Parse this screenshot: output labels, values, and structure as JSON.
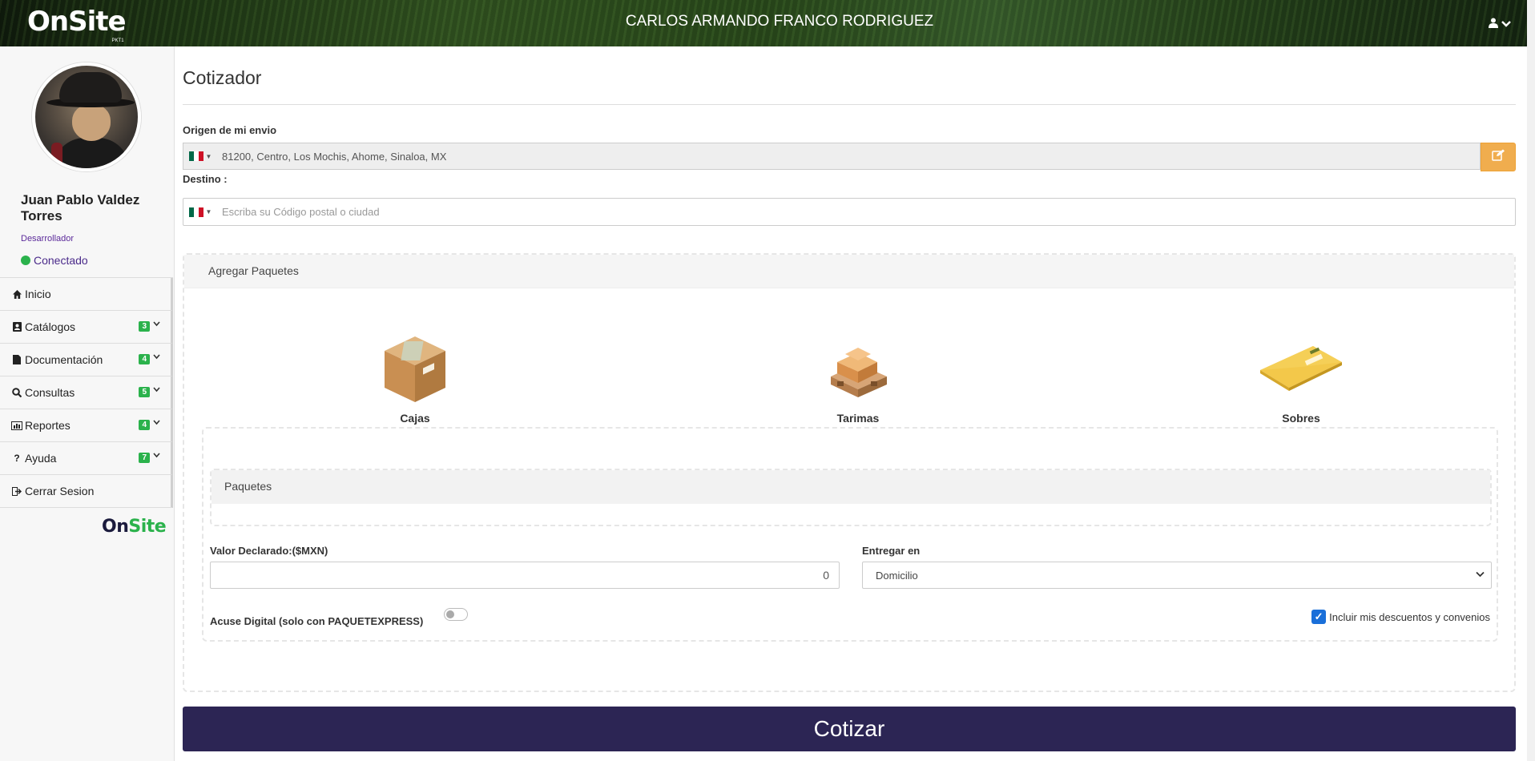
{
  "header": {
    "logo": "OnSite",
    "logo_sub": "PKT1",
    "user_full_name": "CARLOS ARMANDO FRANCO RODRIGUEZ",
    "user_icon": "user-icon",
    "dropdown_icon": "chevron-down-icon"
  },
  "sidebar": {
    "profile": {
      "name": "Juan Pablo Valdez Torres",
      "role": "Desarrollador",
      "status": "Conectado",
      "status_color": "#2bb24c"
    },
    "items": [
      {
        "label": "Inicio",
        "icon": "home-icon"
      },
      {
        "label": "Catálogos",
        "icon": "address-book-icon",
        "badge": "3"
      },
      {
        "label": "Documentación",
        "icon": "file-icon",
        "badge": "4"
      },
      {
        "label": "Consultas",
        "icon": "search-icon",
        "badge": "5"
      },
      {
        "label": "Reportes",
        "icon": "bar-chart-icon",
        "badge": "4"
      },
      {
        "label": "Ayuda",
        "icon": "question-icon",
        "badge": "7"
      },
      {
        "label": "Cerrar Sesion",
        "icon": "sign-out-icon"
      }
    ],
    "footer_logo": {
      "part1": "On",
      "part2": "Site"
    }
  },
  "main": {
    "title": "Cotizador",
    "origin_label": "Origen de mi envio",
    "origin_value": "81200, Centro, Los Mochis, Ahome, Sinaloa, MX",
    "destination_label": "Destino :",
    "destination_placeholder": "Escriba su Código postal o ciudad",
    "packages_panel": {
      "title": "Agregar Paquetes",
      "types": [
        {
          "label": "Cajas",
          "icon": "box-icon"
        },
        {
          "label": "Tarimas",
          "icon": "pallet-icon"
        },
        {
          "label": "Sobres",
          "icon": "envelope-icon"
        }
      ],
      "paquetes_title": "Paquetes"
    },
    "declared_value_label": "Valor Declarado:($MXN)",
    "declared_value": "0",
    "deliver_label": "Entregar en",
    "deliver_value": "Domicilio",
    "acuse_label": "Acuse Digital (solo con PAQUETEXPRESS)",
    "acuse_enabled": false,
    "discount_label": "Incluir mis descuentos y convenios",
    "discount_checked": true,
    "submit_label": "Cotizar"
  },
  "colors": {
    "primary_button": "#2c2554",
    "edit_button": "#f0ad4e",
    "badge": "#2bb24c",
    "checkbox": "#1a6fd9"
  }
}
